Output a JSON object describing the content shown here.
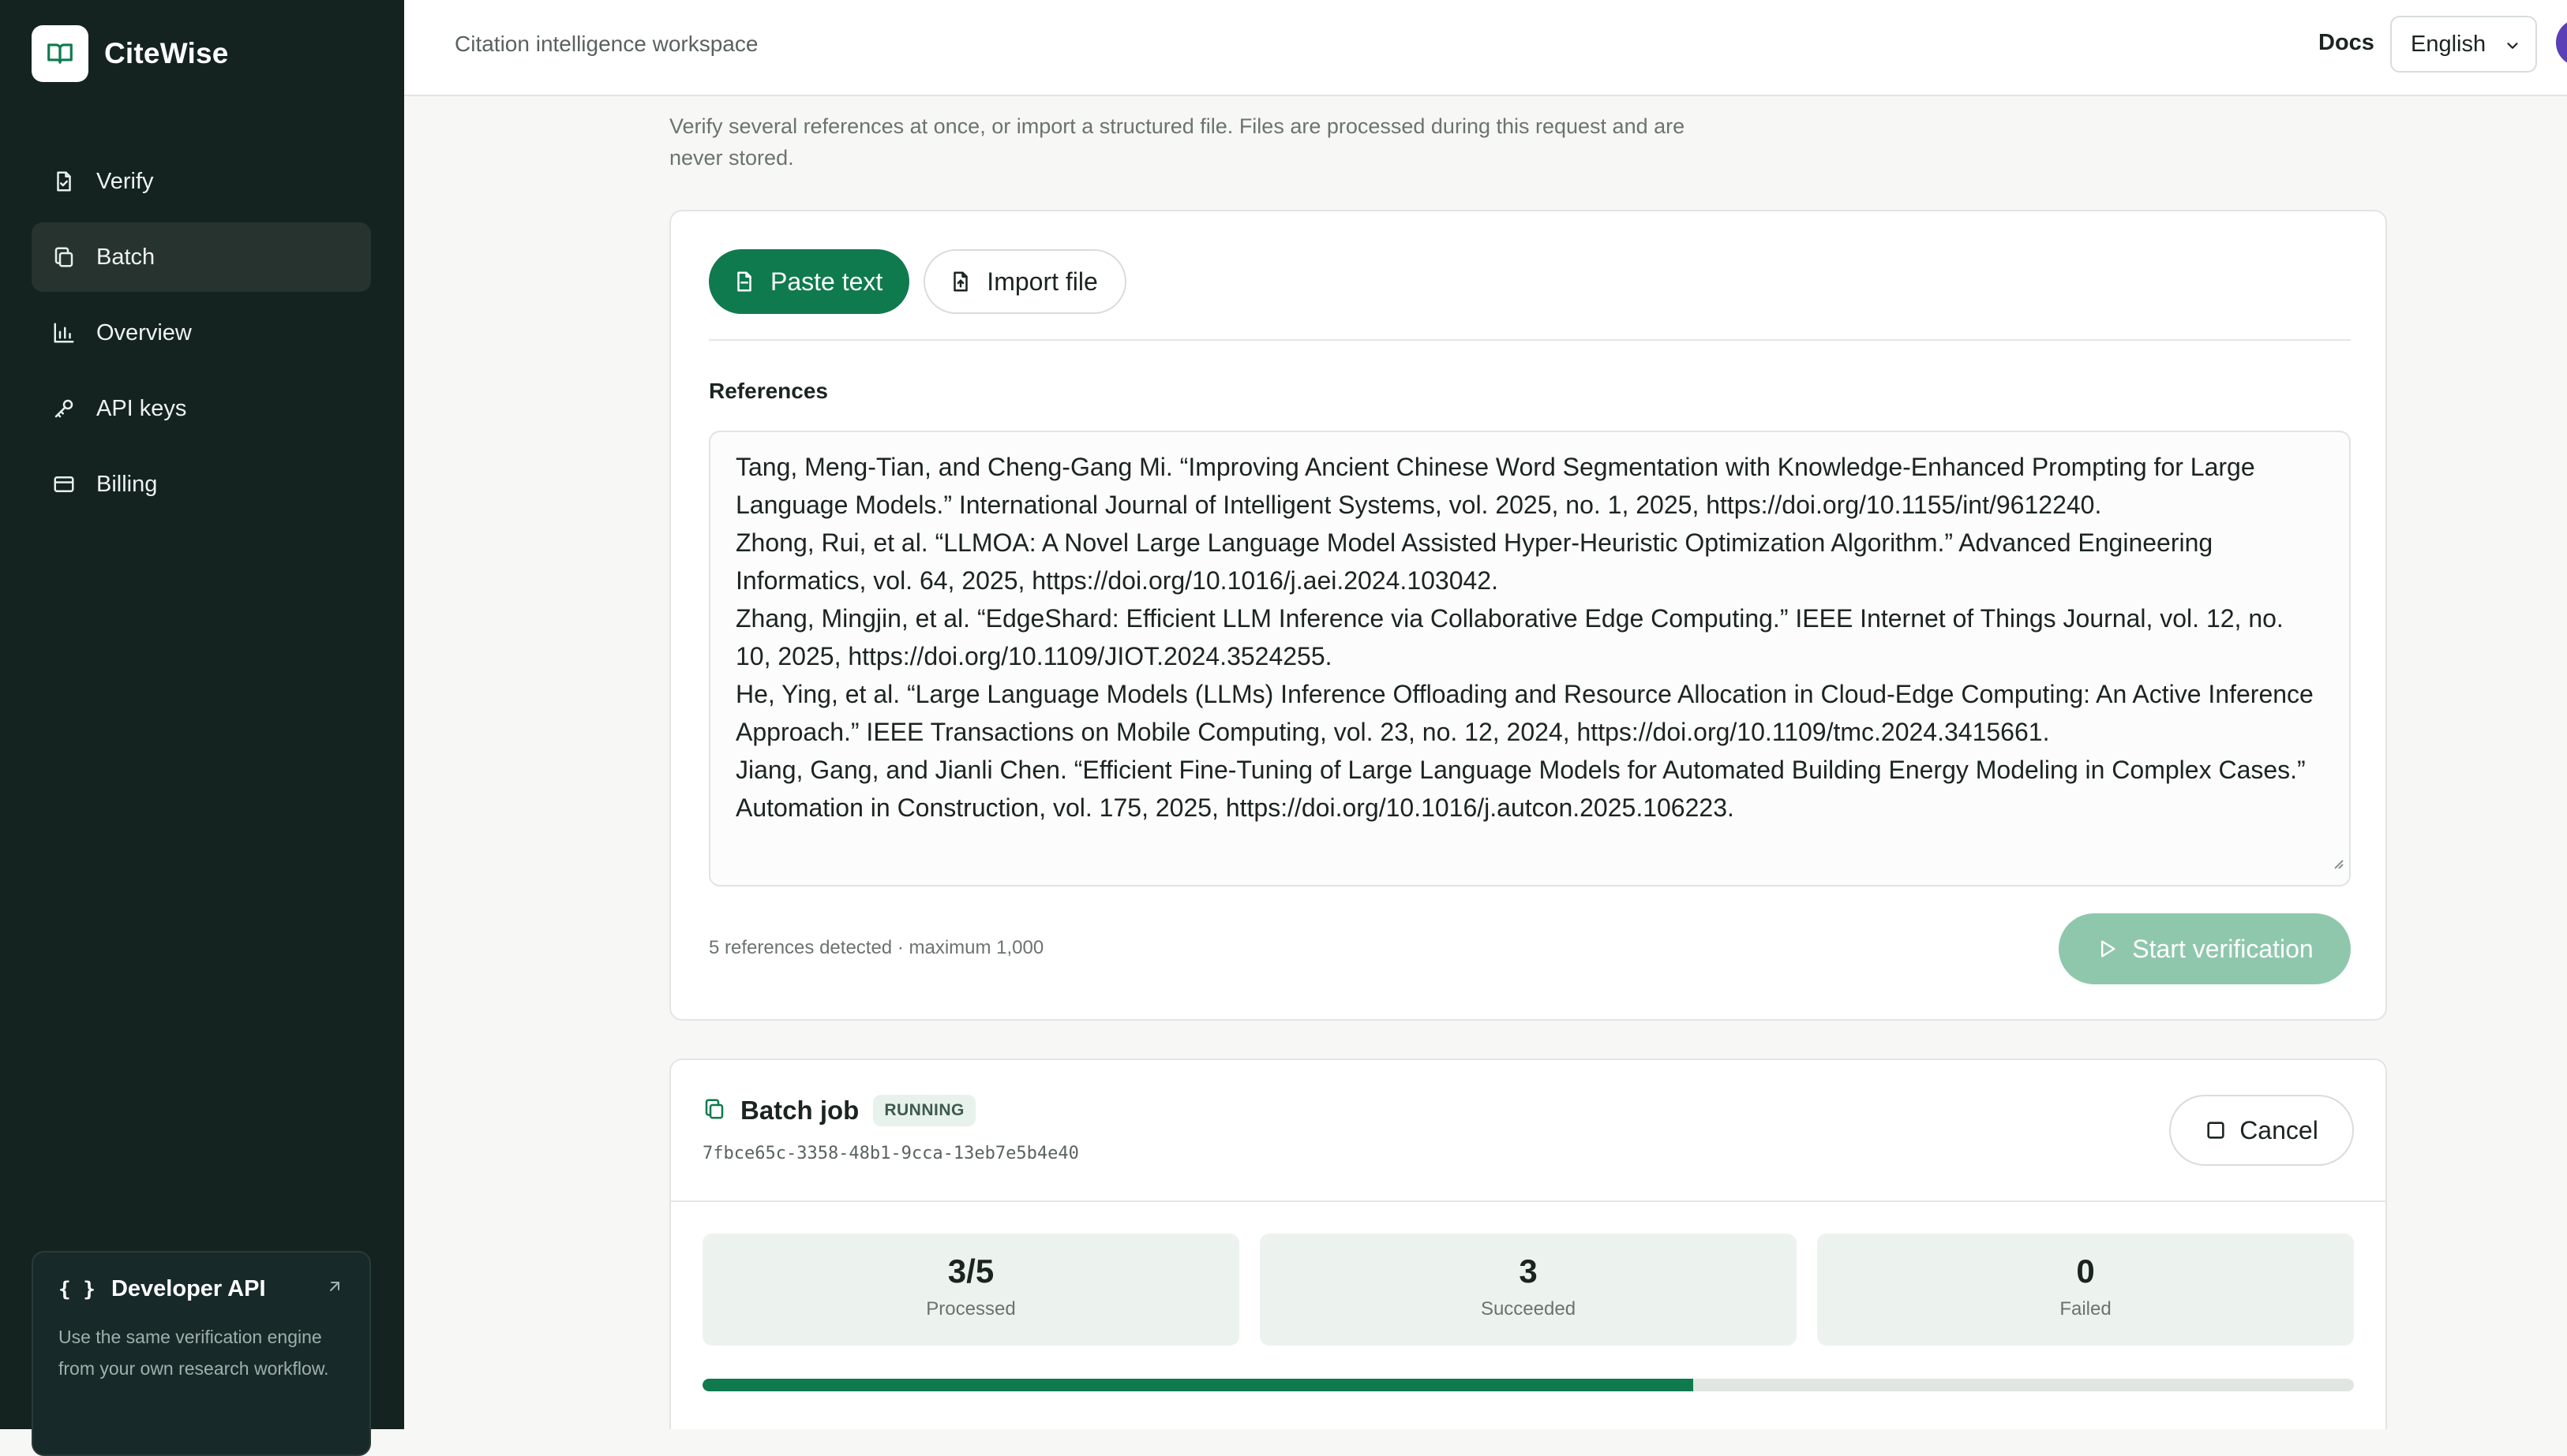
{
  "brand": {
    "name": "CiteWise"
  },
  "sidebar": {
    "items": [
      {
        "label": "Verify",
        "icon": "document-check-icon"
      },
      {
        "label": "Batch",
        "icon": "copy-icon",
        "active": true
      },
      {
        "label": "Overview",
        "icon": "bar-chart-icon"
      },
      {
        "label": "API keys",
        "icon": "key-icon"
      },
      {
        "label": "Billing",
        "icon": "credit-card-icon"
      }
    ],
    "developer": {
      "title": "Developer API",
      "description": "Use the same verification engine from your own research workflow."
    }
  },
  "topbar": {
    "title": "Citation intelligence workspace",
    "docs": "Docs",
    "language": "English"
  },
  "main": {
    "subtitle": "Verify several references at once, or import a structured file. Files are processed during this request and are never stored.",
    "tabs": [
      {
        "label": "Paste text",
        "active": true
      },
      {
        "label": "Import file",
        "active": false
      }
    ],
    "references_label": "References",
    "references": [
      "Tang, Meng-Tian, and Cheng-Gang Mi. “Improving Ancient Chinese Word Segmentation with Knowledge-Enhanced Prompting for Large Language Models.” International Journal of Intelligent Systems, vol. 2025, no. 1, 2025, https://doi.org/10.1155/int/9612240.",
      "Zhong, Rui, et al. “LLMOA: A Novel Large Language Model Assisted Hyper-Heuristic Optimization Algorithm.” Advanced Engineering Informatics, vol. 64, 2025, https://doi.org/10.1016/j.aei.2024.103042.",
      "Zhang, Mingjin, et al. “EdgeShard: Efficient LLM Inference via Collaborative Edge Computing.” IEEE Internet of Things Journal, vol. 12, no. 10, 2025, https://doi.org/10.1109/JIOT.2024.3524255.",
      "He, Ying, et al. “Large Language Models (LLMs) Inference Offloading and Resource Allocation in Cloud-Edge Computing: An Active Inference Approach.” IEEE Transactions on Mobile Computing, vol. 23, no. 12, 2024, https://doi.org/10.1109/tmc.2024.3415661.",
      "Jiang, Gang, and Jianli Chen. “Efficient Fine-Tuning of Large Language Models for Automated Building Energy Modeling in Complex Cases.” Automation in Construction, vol. 175, 2025, https://doi.org/10.1016/j.autcon.2025.106223."
    ],
    "count_note": "5 references detected · maximum 1,000",
    "start_button": "Start verification"
  },
  "job": {
    "title": "Batch job",
    "status": "RUNNING",
    "id": "7fbce65c-3358-48b1-9cca-13eb7e5b4e40",
    "cancel": "Cancel",
    "stats": [
      {
        "value": "3/5",
        "label": "Processed"
      },
      {
        "value": "3",
        "label": "Succeeded"
      },
      {
        "value": "0",
        "label": "Failed"
      }
    ],
    "progress": 0.6
  },
  "colors": {
    "accent": "#0f7a4e",
    "sidebar_bg": "#142320",
    "disabled_accent": "#8fc7ad"
  }
}
